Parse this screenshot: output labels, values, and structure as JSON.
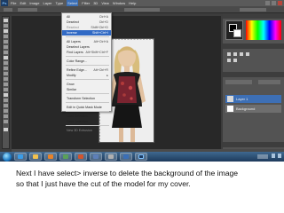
{
  "app": {
    "name": "Adobe Photoshop CS6"
  },
  "menubar": {
    "items": [
      "File",
      "Edit",
      "Image",
      "Layer",
      "Type",
      "Select",
      "Filter",
      "3D",
      "View",
      "Window",
      "Help"
    ],
    "active": "Select"
  },
  "select_menu": {
    "items": [
      {
        "label": "All",
        "shortcut": "Ctrl+A"
      },
      {
        "label": "Deselect",
        "shortcut": "Ctrl+D"
      },
      {
        "label": "Reselect",
        "shortcut": "Shift+Ctrl+D"
      },
      {
        "label": "Inverse",
        "shortcut": "Shift+Ctrl+I"
      },
      {
        "sep": true
      },
      {
        "label": "All Layers",
        "shortcut": "Alt+Ctrl+A"
      },
      {
        "label": "Deselect Layers",
        "shortcut": ""
      },
      {
        "label": "Find Layers",
        "shortcut": "Alt+Shift+Ctrl+F"
      },
      {
        "sep": true
      },
      {
        "label": "Color Range...",
        "shortcut": ""
      },
      {
        "sep": true
      },
      {
        "label": "Refine Edge...",
        "shortcut": "Alt+Ctrl+R"
      },
      {
        "label": "Modify",
        "shortcut": "▸"
      },
      {
        "sep": true
      },
      {
        "label": "Grow",
        "shortcut": ""
      },
      {
        "label": "Similar",
        "shortcut": ""
      },
      {
        "sep": true
      },
      {
        "label": "Transform Selection",
        "shortcut": ""
      },
      {
        "sep": true
      },
      {
        "label": "Edit in Quick Mask Mode",
        "shortcut": ""
      },
      {
        "sep": true
      },
      {
        "label": "Load Selection...",
        "shortcut": ""
      },
      {
        "label": "Save Selection...",
        "shortcut": ""
      },
      {
        "sep": true
      },
      {
        "label": "New 3D Extrusion",
        "shortcut": ""
      }
    ],
    "highlighted": "Inverse",
    "disabled": [
      "Reselect",
      "New 3D Extrusion"
    ]
  },
  "layers_panel": {
    "layers": [
      {
        "name": "Layer 1",
        "selected": true
      },
      {
        "name": "Background",
        "selected": false
      }
    ]
  },
  "caption": {
    "line1": "Next I have select> inverse to delete the background of the image",
    "line2": "so that I just have the cut of the model for my cover."
  },
  "colors": {
    "workspace": "#3c3c3c",
    "canvas_bg": "#282828",
    "menu_highlight": "#316ac5",
    "taskbar": "#1d3a5c"
  }
}
